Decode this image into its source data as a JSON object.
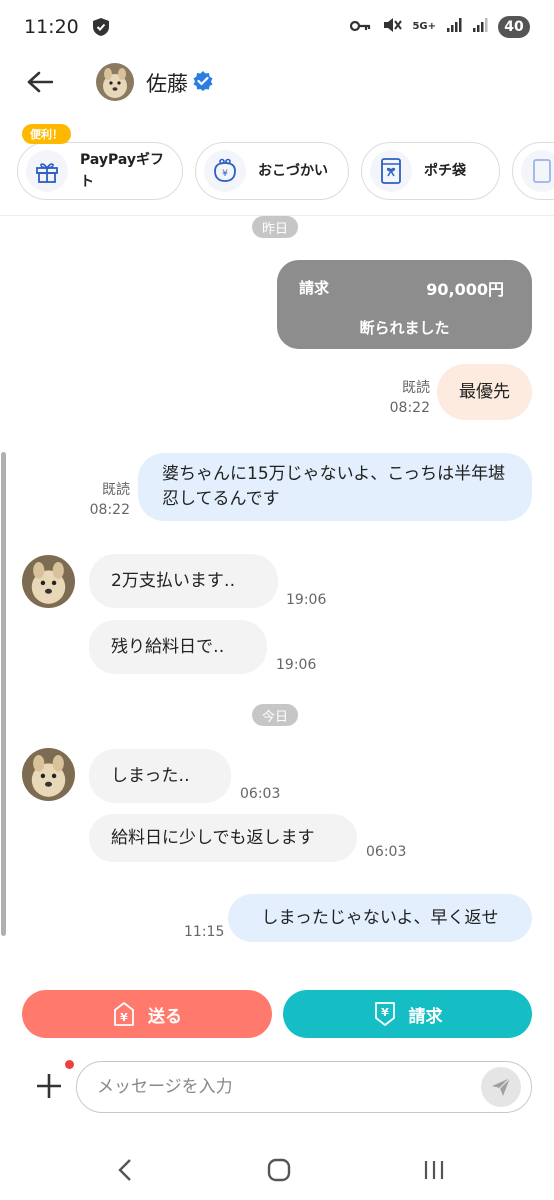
{
  "status_bar": {
    "time": "11:20",
    "network": "5G+",
    "battery": "40"
  },
  "header": {
    "contact_name": "佐藤",
    "verified": true
  },
  "quick_actions": {
    "badge": "便利！",
    "items": [
      {
        "label": "PayPayギフト",
        "icon": "gift-icon"
      },
      {
        "label": "おこづかい",
        "icon": "coin-purse-icon"
      },
      {
        "label": "ポチ袋",
        "icon": "envelope-icon"
      }
    ]
  },
  "chat": {
    "dates": {
      "yesterday": "昨日",
      "today": "今日"
    },
    "request_card": {
      "label": "請求",
      "amount": "90,000円",
      "status": "断られました"
    },
    "messages": [
      {
        "sender": "me",
        "text": "最優先",
        "read": "既読",
        "time": "08:22"
      },
      {
        "sender": "me",
        "text": "婆ちゃんに15万じゃないよ、こっちは半年堪忍してるんです",
        "read": "既読",
        "time": "08:22"
      },
      {
        "sender": "them",
        "text": "2万支払います‥",
        "time": "19:06"
      },
      {
        "sender": "them",
        "text": "残り給料日で‥",
        "time": "19:06"
      },
      {
        "sender": "them",
        "text": "しまった‥",
        "time": "06:03"
      },
      {
        "sender": "them",
        "text": "給料日に少しでも返します",
        "time": "06:03"
      },
      {
        "sender": "me",
        "text": "しまったじゃないよ、早く返せ",
        "time": "11:15"
      }
    ]
  },
  "actions": {
    "send_label": "送る",
    "request_label": "請求"
  },
  "composer": {
    "placeholder": "メッセージを入力",
    "value": ""
  },
  "colors": {
    "send_button": "#ff7a6d",
    "request_button": "#14bec4",
    "my_bubble": "#e3effc",
    "their_bubble": "#f3f3f3",
    "verified_badge": "#2a7de1"
  }
}
